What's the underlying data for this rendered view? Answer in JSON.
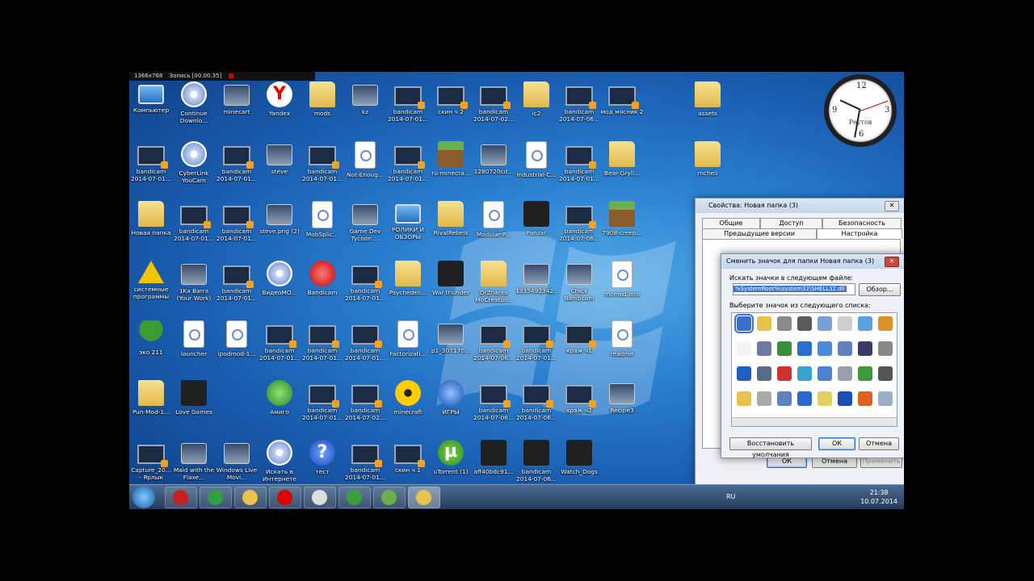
{
  "recorder": {
    "resolution": "1366x768",
    "recording": "Запись [00.00.35]"
  },
  "desktop_icons": [
    {
      "label": "Компьютер",
      "col": 0,
      "row": 0,
      "type": "comp"
    },
    {
      "label": "Continue Downlo...",
      "col": 1,
      "row": 0,
      "type": "cd"
    },
    {
      "label": "minecart",
      "col": 2,
      "row": 0,
      "type": "img"
    },
    {
      "label": "Yandex",
      "col": 3,
      "row": 0,
      "type": "yandex"
    },
    {
      "label": "mods",
      "col": 4,
      "row": 0,
      "type": "folder"
    },
    {
      "label": "kz",
      "col": 5,
      "row": 0,
      "type": "img"
    },
    {
      "label": "bandicam 2014-07-01...",
      "col": 6,
      "row": 0,
      "type": "video"
    },
    {
      "label": "скин ч 2",
      "col": 7,
      "row": 0,
      "type": "video"
    },
    {
      "label": "bandicam 2014-07-02...",
      "col": 8,
      "row": 0,
      "type": "video"
    },
    {
      "label": "ic2",
      "col": 9,
      "row": 0,
      "type": "folder"
    },
    {
      "label": "bandicam 2014-07-06...",
      "col": 10,
      "row": 0,
      "type": "video"
    },
    {
      "label": "мод мясник 2",
      "col": 11,
      "row": 0,
      "type": "video"
    },
    {
      "label": "assets",
      "col": 13,
      "row": 0,
      "type": "folder"
    },
    {
      "label": "bandicam 2014-07-01...",
      "col": 0,
      "row": 1,
      "type": "video"
    },
    {
      "label": "CyberLink YouCam",
      "col": 1,
      "row": 1,
      "type": "cd"
    },
    {
      "label": "bandicam 2014-07-01...",
      "col": 2,
      "row": 1,
      "type": "video"
    },
    {
      "label": "steve",
      "col": 3,
      "row": 1,
      "type": "img"
    },
    {
      "label": "bandicam 2014-07-01...",
      "col": 4,
      "row": 1,
      "type": "video"
    },
    {
      "label": "Not-Enoug...",
      "col": 5,
      "row": 1,
      "type": "doc"
    },
    {
      "label": "bandicam 2014-07-01...",
      "col": 6,
      "row": 1,
      "type": "video"
    },
    {
      "label": "ru-minecra...",
      "col": 7,
      "row": 1,
      "type": "minecraft"
    },
    {
      "label": "1280720cd...",
      "col": 8,
      "row": 1,
      "type": "img"
    },
    {
      "label": "Industrial-C...",
      "col": 9,
      "row": 1,
      "type": "doc"
    },
    {
      "label": "bandicam 2014-07-01...",
      "col": 10,
      "row": 1,
      "type": "video"
    },
    {
      "label": "Bear-Gryll...",
      "col": 11,
      "row": 1,
      "type": "folder"
    },
    {
      "label": "mcheli",
      "col": 13,
      "row": 1,
      "type": "folder"
    },
    {
      "label": "Новая папка",
      "col": 0,
      "row": 2,
      "type": "folder"
    },
    {
      "label": "bandicam 2014-07-01...",
      "col": 1,
      "row": 2,
      "type": "video"
    },
    {
      "label": "bandicam 2014-07-01...",
      "col": 2,
      "row": 2,
      "type": "video"
    },
    {
      "label": "steve.png (2)",
      "col": 3,
      "row": 2,
      "type": "img"
    },
    {
      "label": "MobSplic...",
      "col": 4,
      "row": 2,
      "type": "doc"
    },
    {
      "label": "Game Dev Tycoon ...",
      "col": 5,
      "row": 2,
      "type": "img"
    },
    {
      "label": "РОЛИКИ И ОБЗОРЫ",
      "col": 6,
      "row": 2,
      "type": "comp"
    },
    {
      "label": "RivalRebels",
      "col": 7,
      "row": 2,
      "type": "folder"
    },
    {
      "label": "Modular-P...",
      "col": 8,
      "row": 2,
      "type": "doc"
    },
    {
      "label": "Panzar",
      "col": 9,
      "row": 2,
      "type": "dark"
    },
    {
      "label": "bandicam 2014-07-06...",
      "col": 10,
      "row": 2,
      "type": "video"
    },
    {
      "label": "7908-creep...",
      "col": 11,
      "row": 2,
      "type": "minecraft"
    },
    {
      "label": "системные программы",
      "col": 0,
      "row": 3,
      "type": "warn"
    },
    {
      "label": "1Ka Barra (Your Work)",
      "col": 1,
      "row": 3,
      "type": "img"
    },
    {
      "label": "bandicam 2014-07-01...",
      "col": 2,
      "row": 3,
      "type": "video"
    },
    {
      "label": "ВидеоМО...",
      "col": 3,
      "row": 3,
      "type": "cd"
    },
    {
      "label": "Bandicam",
      "col": 4,
      "row": 3,
      "type": "red"
    },
    {
      "label": "bandicam 2014-07-01...",
      "col": 5,
      "row": 3,
      "type": "video"
    },
    {
      "label": "Psychedeli...",
      "col": 6,
      "row": 3,
      "type": "folder"
    },
    {
      "label": "War thunder",
      "col": 7,
      "row": 3,
      "type": "dark"
    },
    {
      "label": "DrZharks MoCreatur...",
      "col": 8,
      "row": 3,
      "type": "folder"
    },
    {
      "label": "1335492342...",
      "col": 9,
      "row": 3,
      "type": "img"
    },
    {
      "label": "Crack Bandicam",
      "col": 10,
      "row": 3,
      "type": "img"
    },
    {
      "label": "mcmod.info",
      "col": 11,
      "row": 3,
      "type": "doc"
    },
    {
      "label": "эко 211",
      "col": 0,
      "row": 4,
      "type": "tree"
    },
    {
      "label": "launcher",
      "col": 1,
      "row": 4,
      "type": "doc"
    },
    {
      "label": "ipodmod-1...",
      "col": 2,
      "row": 4,
      "type": "doc"
    },
    {
      "label": "bandicam 2014-07-01...",
      "col": 3,
      "row": 4,
      "type": "video"
    },
    {
      "label": "bandicam 2014-07-01...",
      "col": 4,
      "row": 4,
      "type": "video"
    },
    {
      "label": "bandicam 2014-07-01...",
      "col": 5,
      "row": 4,
      "type": "video"
    },
    {
      "label": "Factorizati...",
      "col": 6,
      "row": 4,
      "type": "doc"
    },
    {
      "label": "p1_307170...",
      "col": 7,
      "row": 4,
      "type": "img"
    },
    {
      "label": "bandicam 2014-07-06...",
      "col": 8,
      "row": 4,
      "type": "video"
    },
    {
      "label": "bandicam 2014-07-01...",
      "col": 9,
      "row": 4,
      "type": "video"
    },
    {
      "label": "краж ч1",
      "col": 10,
      "row": 4,
      "type": "video"
    },
    {
      "label": "readme",
      "col": 11,
      "row": 4,
      "type": "doc"
    },
    {
      "label": "Pun-Mod-1...",
      "col": 0,
      "row": 5,
      "type": "folder"
    },
    {
      "label": "Love Games",
      "col": 1,
      "row": 5,
      "type": "dark"
    },
    {
      "label": "Амиго",
      "col": 3,
      "row": 5,
      "type": "green"
    },
    {
      "label": "bandicam 2014-07-01...",
      "col": 4,
      "row": 5,
      "type": "video"
    },
    {
      "label": "bandicam 2014-07-02...",
      "col": 5,
      "row": 5,
      "type": "video"
    },
    {
      "label": "minecraft",
      "col": 6,
      "row": 5,
      "type": "nuke"
    },
    {
      "label": "ИГРЫ",
      "col": 7,
      "row": 5,
      "type": "blue"
    },
    {
      "label": "bandicam 2014-07-06...",
      "col": 8,
      "row": 5,
      "type": "video"
    },
    {
      "label": "bandicam 2014-07-06...",
      "col": 9,
      "row": 5,
      "type": "video"
    },
    {
      "label": "краж ч2",
      "col": 10,
      "row": 5,
      "type": "video"
    },
    {
      "label": "Recipe3",
      "col": 11,
      "row": 5,
      "type": "img"
    },
    {
      "label": "Capture_20... - Ярлык",
      "col": 0,
      "row": 6,
      "type": "video"
    },
    {
      "label": "Maid with the Flaxe...",
      "col": 1,
      "row": 6,
      "type": "img"
    },
    {
      "label": "Windows Live Movi...",
      "col": 2,
      "row": 6,
      "type": "img"
    },
    {
      "label": "Искать в Интернете",
      "col": 3,
      "row": 6,
      "type": "cd"
    },
    {
      "label": "тест",
      "col": 4,
      "row": 6,
      "type": "help"
    },
    {
      "label": "bandicam 2014-07-01...",
      "col": 5,
      "row": 6,
      "type": "video"
    },
    {
      "label": "скин ч 1",
      "col": 6,
      "row": 6,
      "type": "video"
    },
    {
      "label": "uTorrent (1)",
      "col": 7,
      "row": 6,
      "type": "utor"
    },
    {
      "label": "aff40bdc91...",
      "col": 8,
      "row": 6,
      "type": "dark"
    },
    {
      "label": "bandicam 2014-07-06...",
      "col": 9,
      "row": 6,
      "type": "dark"
    },
    {
      "label": "Watch_Dogs",
      "col": 10,
      "row": 6,
      "type": "dark"
    }
  ],
  "clock": {
    "city": "Реутов",
    "numbers": [
      "12",
      "3",
      "6",
      "9",
      "1",
      "2",
      "4",
      "5",
      "7",
      "8",
      "10",
      "11"
    ]
  },
  "properties": {
    "title": "Свойства: Новая папка (3)",
    "tabs_row1": [
      "Общие",
      "Доступ",
      "Безопасность"
    ],
    "tabs_row2": [
      "Предыдущие версии",
      "Настройка"
    ],
    "ok": "ОК",
    "cancel": "Отмена",
    "apply": "Применить"
  },
  "change_icon": {
    "title": "Сменить значок для папки Новая папка (3)",
    "find_label": "Искать значки в следующем файле:",
    "file_value": "%SystemRoot%\\system32\\SHELL32.dll",
    "browse": "Обзор...",
    "select_label": "Выберите значок из следующего списка:",
    "restore": "Восстановить умолчания",
    "ok": "ОК",
    "cancel": "Отмена"
  },
  "taskbar": {
    "language": "RU",
    "time": "21:38",
    "date": "10.07.2014",
    "buttons": [
      "bandicam",
      "chrome",
      "explorer",
      "yandex",
      "notepad",
      "utorrent",
      "minecraft",
      "folders"
    ]
  }
}
